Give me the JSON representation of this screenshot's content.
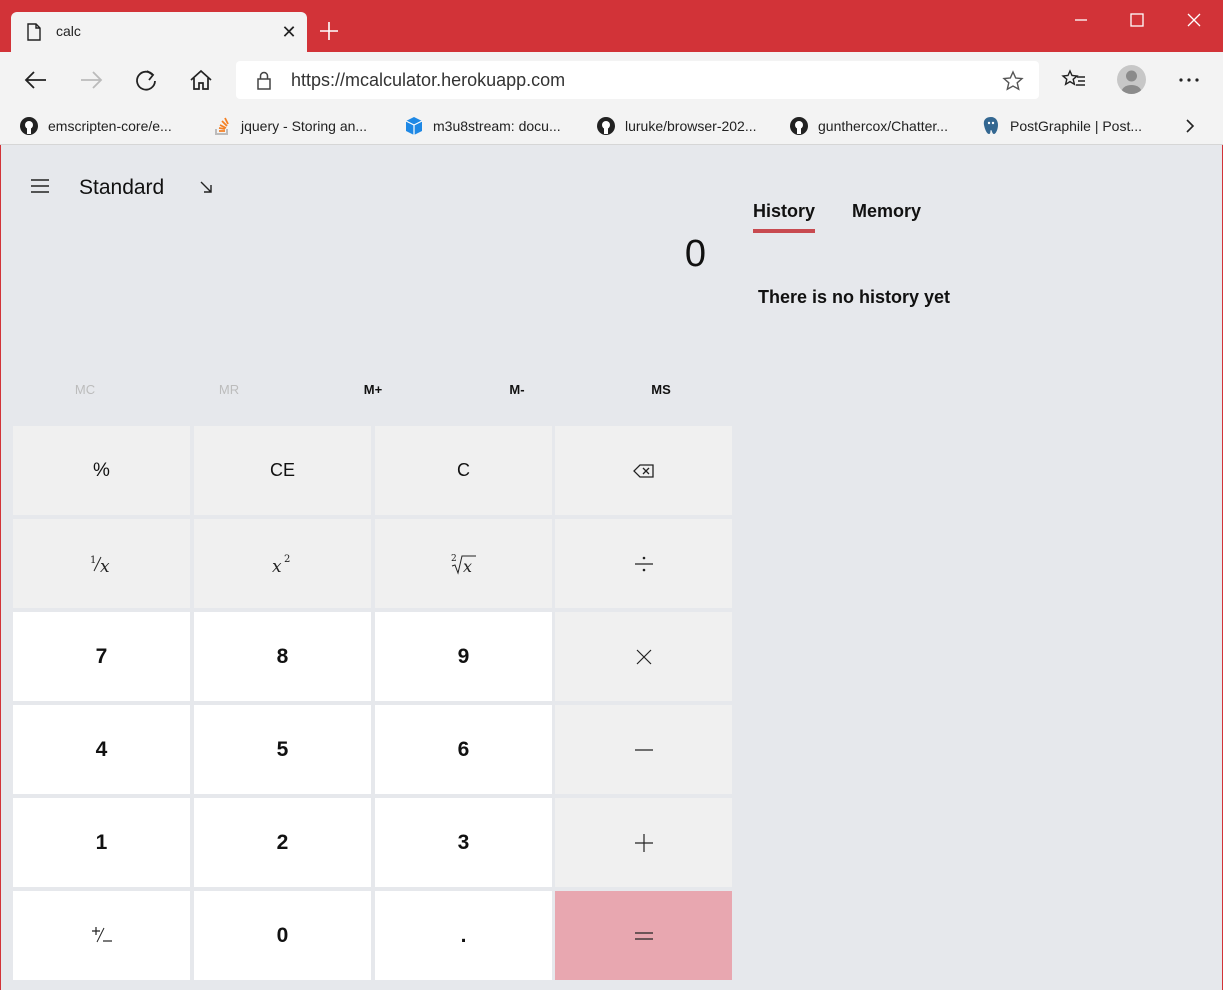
{
  "browser": {
    "tab": {
      "title": "calc"
    },
    "address": {
      "url": "https://mcalculator.herokuapp.com"
    },
    "bookmarks": [
      {
        "label": "emscripten-core/e...",
        "icon": "github-icon"
      },
      {
        "label": "jquery - Storing an...",
        "icon": "stackoverflow-icon"
      },
      {
        "label": "m3u8stream: docu...",
        "icon": "cube-icon"
      },
      {
        "label": "luruke/browser-202...",
        "icon": "github-icon"
      },
      {
        "label": "gunthercox/Chatter...",
        "icon": "github-icon"
      },
      {
        "label": "PostGraphile | Post...",
        "icon": "postgres-icon"
      }
    ]
  },
  "calculator": {
    "mode": "Standard",
    "display": "0",
    "memory_buttons": [
      {
        "label": "MC",
        "enabled": false
      },
      {
        "label": "MR",
        "enabled": false
      },
      {
        "label": "M+",
        "enabled": true
      },
      {
        "label": "M-",
        "enabled": true
      },
      {
        "label": "MS",
        "enabled": true
      }
    ],
    "keys": {
      "percent": "%",
      "ce": "CE",
      "c": "C",
      "seven": "7",
      "eight": "8",
      "nine": "9",
      "four": "4",
      "five": "5",
      "six": "6",
      "one": "1",
      "two": "2",
      "three": "3",
      "zero": "0",
      "decimal": "."
    }
  },
  "panel": {
    "tabs": [
      "History",
      "Memory"
    ],
    "active_tab": "History",
    "history_empty": "There is no history yet"
  },
  "colors": {
    "titlebar": "#d23338",
    "accent_underline": "#c84a50",
    "equals_key": "#e8a7b0",
    "app_background": "#e6e8ec"
  }
}
